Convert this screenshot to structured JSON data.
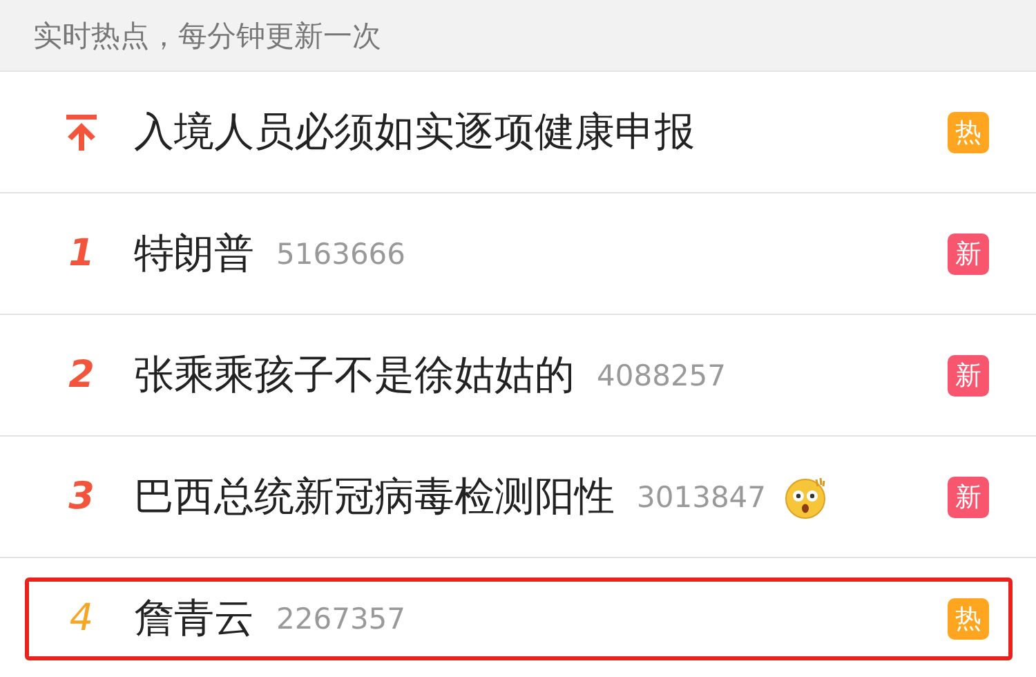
{
  "header": {
    "text": "实时热点，每分钟更新一次"
  },
  "rows": [
    {
      "kind": "pinned",
      "title": "入境人员必须如实逐项健康申报",
      "badge": {
        "kind": "hot",
        "label": "热"
      },
      "has_emoji": false,
      "highlighted": false
    },
    {
      "kind": "ranked",
      "rank": "1",
      "color": "#f2553b",
      "title": "特朗普",
      "count": "5163666",
      "badge": {
        "kind": "new",
        "label": "新"
      },
      "has_emoji": false,
      "highlighted": false
    },
    {
      "kind": "ranked",
      "rank": "2",
      "color": "#f2553b",
      "title": "张乘乘孩子不是徐姑姑的",
      "count": "4088257",
      "badge": {
        "kind": "new",
        "label": "新"
      },
      "has_emoji": false,
      "highlighted": false
    },
    {
      "kind": "ranked",
      "rank": "3",
      "color": "#f2553b",
      "title": "巴西总统新冠病毒检测阳性",
      "count": "3013847",
      "badge": {
        "kind": "new",
        "label": "新"
      },
      "has_emoji": true,
      "highlighted": false
    },
    {
      "kind": "ranked",
      "rank": "4",
      "color": "#f5a623",
      "title": "詹青云",
      "count": "2267357",
      "badge": {
        "kind": "hot",
        "label": "热"
      },
      "has_emoji": false,
      "highlighted": true
    }
  ]
}
